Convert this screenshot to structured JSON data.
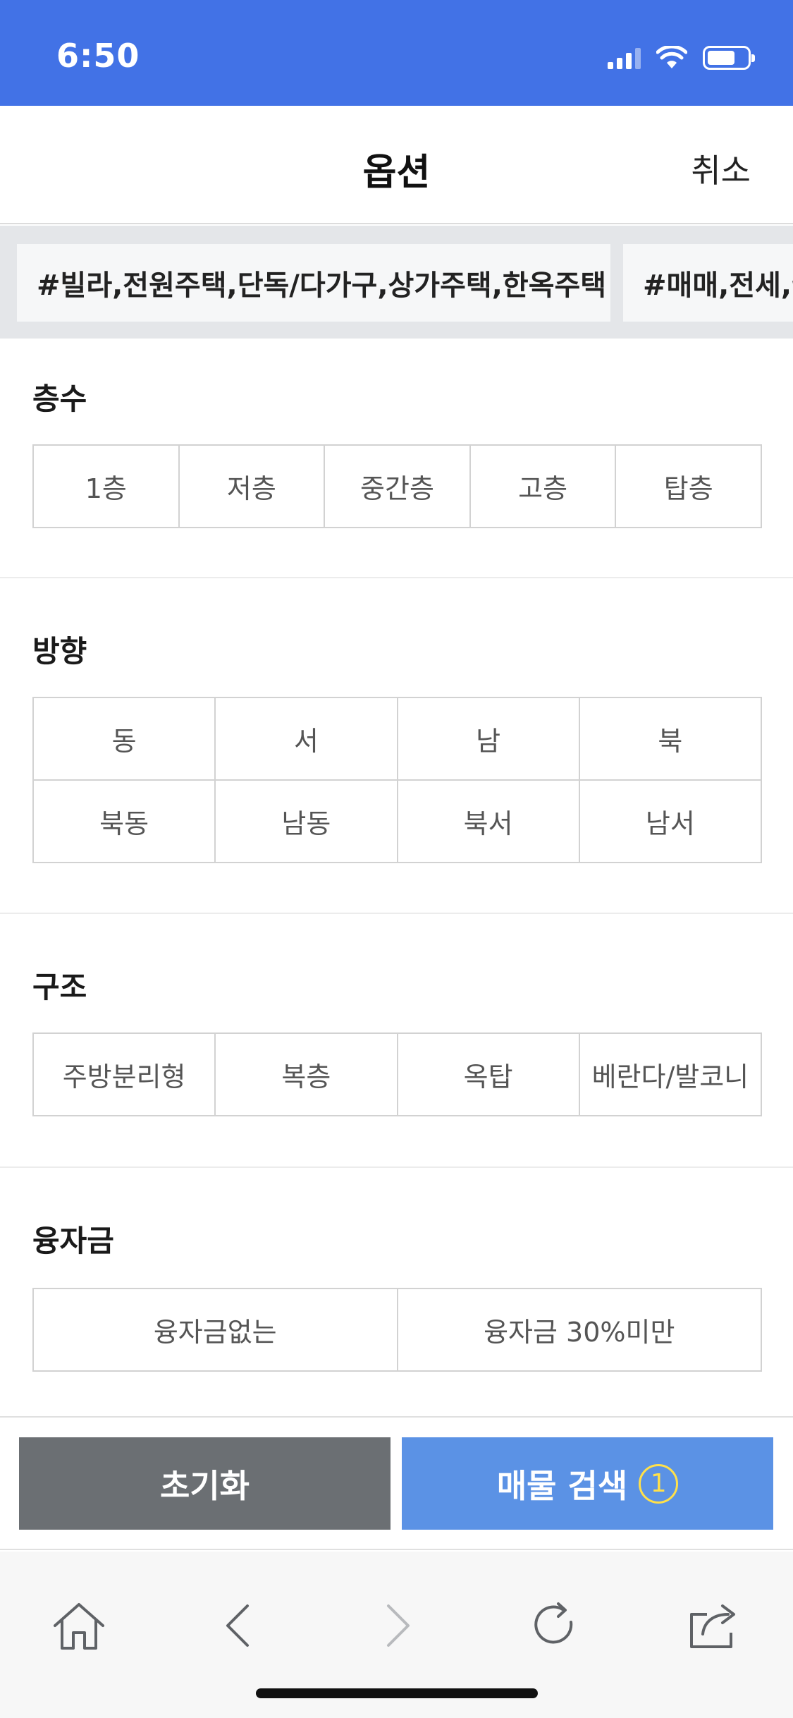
{
  "status_bar": {
    "time": "6:50",
    "color": "#4272e6"
  },
  "header": {
    "title": "옵션",
    "cancel_label": "취소"
  },
  "tags": [
    "#빌라,전원주택,단독/다가구,상가주택,한옥주택",
    "#매매,전세,월"
  ],
  "sections": {
    "floors": {
      "title": "층수",
      "options": [
        "1층",
        "저층",
        "중간층",
        "고층",
        "탑층"
      ]
    },
    "direction": {
      "title": "방향",
      "options": [
        "동",
        "서",
        "남",
        "북",
        "북동",
        "남동",
        "북서",
        "남서"
      ]
    },
    "structure": {
      "title": "구조",
      "options": [
        "주방분리형",
        "복층",
        "옥탑",
        "베란다/발코니"
      ]
    },
    "loan": {
      "title": "융자금",
      "options": [
        "융자금없는",
        "융자금 30%미만"
      ]
    }
  },
  "actions": {
    "reset_label": "초기화",
    "search_label": "매물 검색",
    "search_count": "1",
    "reset_color": "#6b6f73",
    "search_color": "#5b92e5"
  },
  "browser_toolbar": {
    "icons": [
      "home-icon",
      "back-icon",
      "forward-icon",
      "reload-icon",
      "share-icon"
    ]
  }
}
